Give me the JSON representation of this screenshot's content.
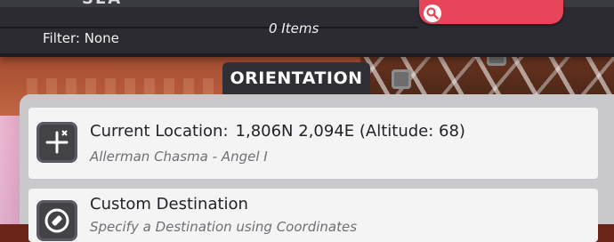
{
  "topbar": {
    "cut_title": "SEA",
    "filter_label": "Filter: None",
    "items_count": "0 Items",
    "search": {
      "placeholder": ""
    }
  },
  "section": {
    "title": "ORIENTATION"
  },
  "cards": [
    {
      "title": "Current Location:",
      "value": "1,806N 2,094E (Altitude: 68)",
      "subtitle": "Allerman Chasma - Angel I",
      "icon": "crosshair-compass-icon"
    },
    {
      "title": "Custom Destination",
      "value": "",
      "subtitle": "Specify a Destination using Coordinates",
      "icon": "pin-compass-icon"
    }
  ],
  "colors": {
    "accent": "#e8455b",
    "panel": "#c9c9cc",
    "card": "#f4f4f5",
    "bar": "#2b2b31"
  }
}
